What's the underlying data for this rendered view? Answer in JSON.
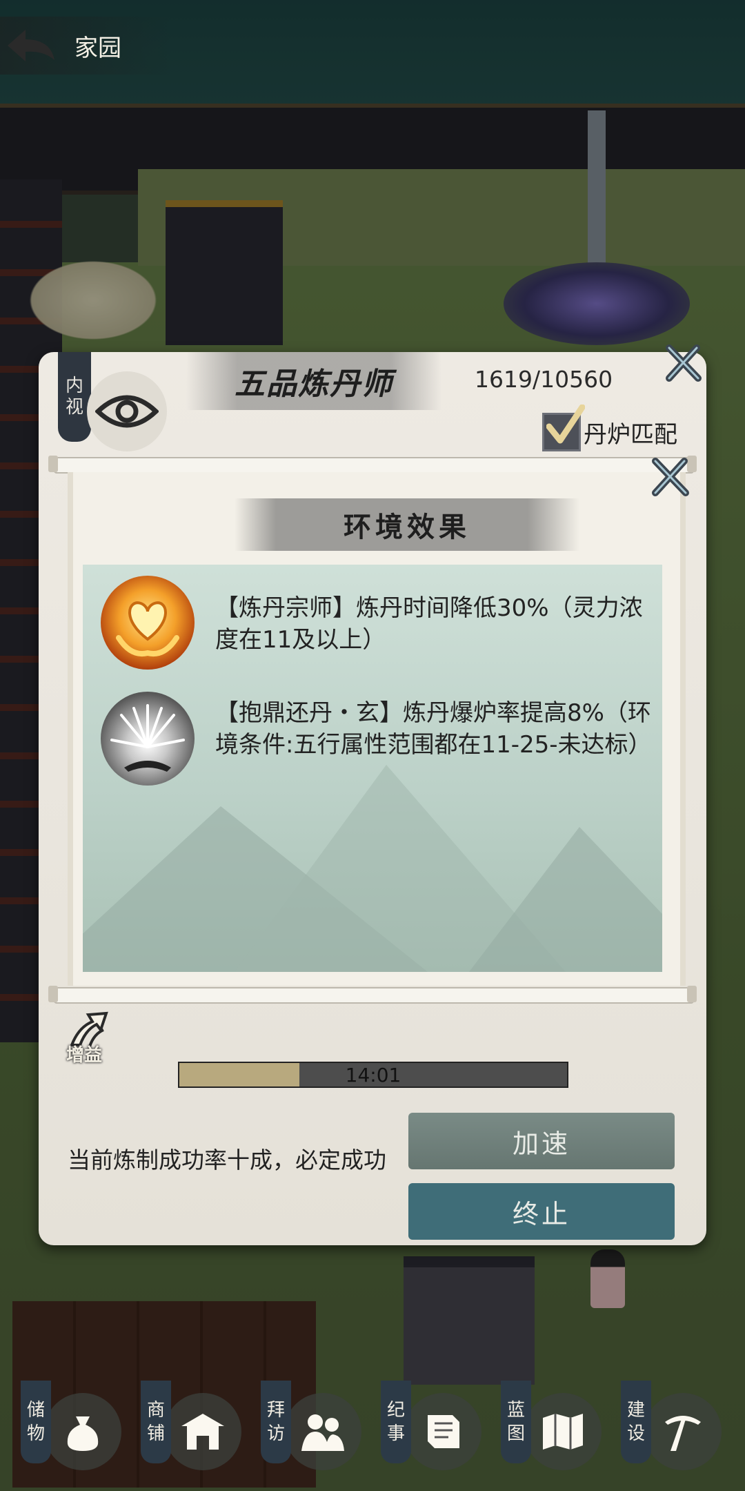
{
  "top_bar": {
    "title": "家园"
  },
  "dialog": {
    "badge_text": [
      "内",
      "视"
    ],
    "title": "五品炼丹师",
    "exp": "1619/10560",
    "checkbox_label": "丹炉匹配",
    "checkbox_checked": true,
    "panel": {
      "title": "环境效果",
      "effects": [
        {
          "icon": "golden-heart-hands-icon",
          "text": "【炼丹宗师】炼丹时间降低30%（灵力浓度在11及以上）"
        },
        {
          "icon": "burst-explosion-icon",
          "text": "【抱鼎还丹・玄】炼丹爆炉率提高8%（环境条件:五行属性范围都在11-25-未达标）"
        }
      ]
    },
    "buff_label": "增益",
    "timer": "14:01",
    "timer_progress": 0.31,
    "status": "当前炼制成功率十成，必定成功",
    "buttons": {
      "speed_up": "加速",
      "stop": "终止"
    }
  },
  "bottom_nav": [
    {
      "label": [
        "储",
        "物"
      ],
      "icon": "bag-icon"
    },
    {
      "label": [
        "商",
        "铺"
      ],
      "icon": "shop-icon"
    },
    {
      "label": [
        "拜",
        "访"
      ],
      "icon": "visit-icon"
    },
    {
      "label": [
        "纪",
        "事"
      ],
      "icon": "scroll-icon"
    },
    {
      "label": [
        "蓝",
        "图"
      ],
      "icon": "blueprint-icon"
    },
    {
      "label": [
        "建",
        "设"
      ],
      "icon": "pickaxe-icon"
    }
  ],
  "colors": {
    "accent_button": "#3f6d78",
    "progress_fill": "#b8a97e"
  }
}
